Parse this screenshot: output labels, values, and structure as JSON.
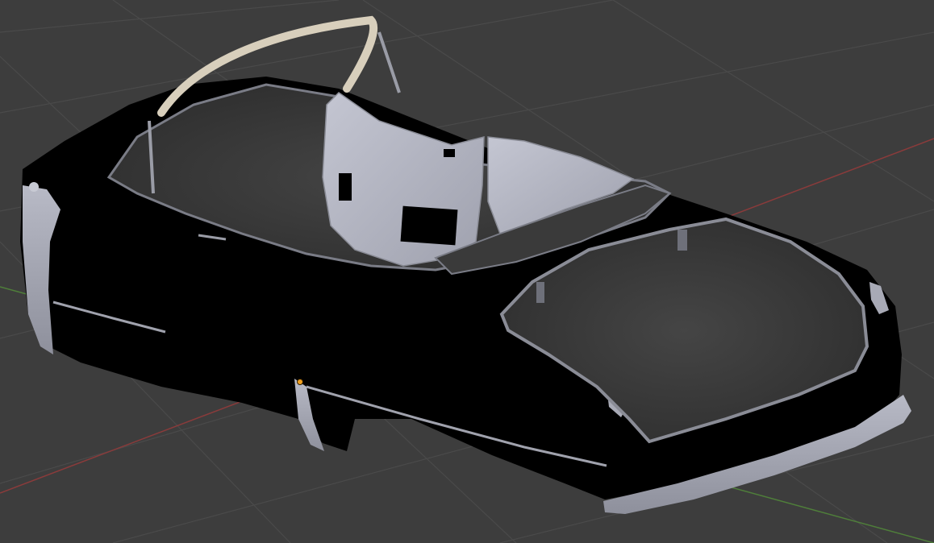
{
  "viewport": {
    "background_color": "#3d3d3d",
    "grid_line_color": "#4a4a4a",
    "x_axis_color": "#8a3b3b",
    "y_axis_color": "#4f7f3a",
    "object_origin_color": "#f0a020"
  },
  "model": {
    "body_color": "#000000",
    "trim_color": "#a0a2ad",
    "interior_panel_color": "#b4b6c4",
    "carpet_color": "#3a3a3a",
    "windshield_frame_color": "#d8cfbc"
  }
}
